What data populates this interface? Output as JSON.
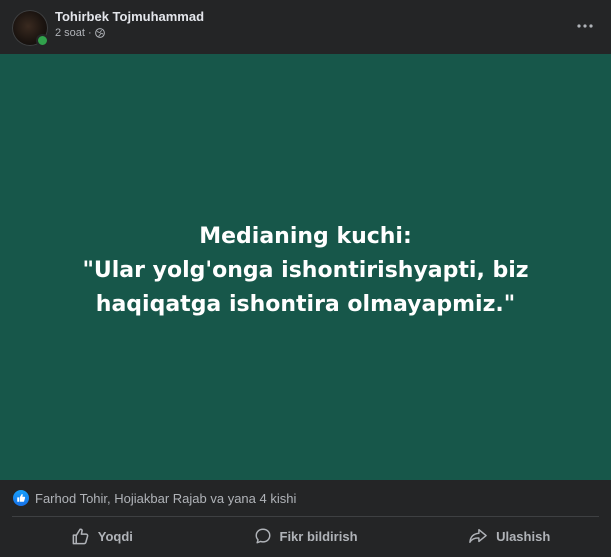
{
  "post": {
    "author": "Tohirbek Tojmuhammad",
    "time": "2 soat",
    "separator": "·",
    "image_text_lines": [
      "Medianing kuchi:",
      "\"Ular yolg'onga ishontirishyapti, biz",
      "haqiqatga ishontira olmayapmiz.\""
    ],
    "image_background": "#17574a"
  },
  "reactions": {
    "summary": "Farhod Tohir, Hojiakbar Rajab va yana 4 kishi",
    "icon": "like-icon"
  },
  "actions": {
    "like_label": "Yoqdi",
    "comment_label": "Fikr bildirish",
    "share_label": "Ulashish"
  },
  "icons": {
    "menu": "more-options-icon",
    "privacy": "globe-icon",
    "like": "thumbs-up-icon",
    "comment": "comment-bubble-icon",
    "share": "share-arrow-icon"
  },
  "colors": {
    "surface": "#242526",
    "text_primary": "#e4e6eb",
    "text_secondary": "#b0b3b8",
    "like_blue": "#1877f2",
    "online": "#31a24c"
  }
}
